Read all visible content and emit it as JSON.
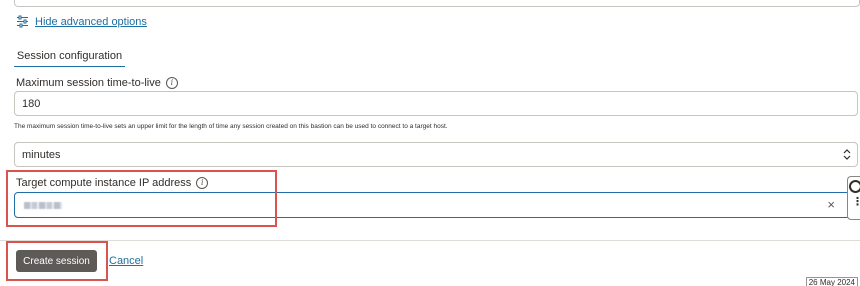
{
  "advanced": {
    "toggle_label": "Hide advanced options",
    "icon": "sliders-icon"
  },
  "section": {
    "tab_label": "Session configuration"
  },
  "ttl": {
    "label": "Maximum session time-to-live",
    "value": "180",
    "helper": "The maximum session time-to-live sets an upper limit for the length of time any session created on this bastion can be used to connect to a target host.",
    "unit_value": "minutes"
  },
  "target_ip": {
    "label": "Target compute instance IP address",
    "value": "",
    "clear_icon": "×"
  },
  "footer": {
    "create_label": "Create session",
    "cancel_label": "Cancel"
  },
  "date_stamp": "26 May 2024",
  "colors": {
    "accent": "#1d6fa5",
    "primary_button": "#5e5a57",
    "highlight": "#d9534f"
  }
}
